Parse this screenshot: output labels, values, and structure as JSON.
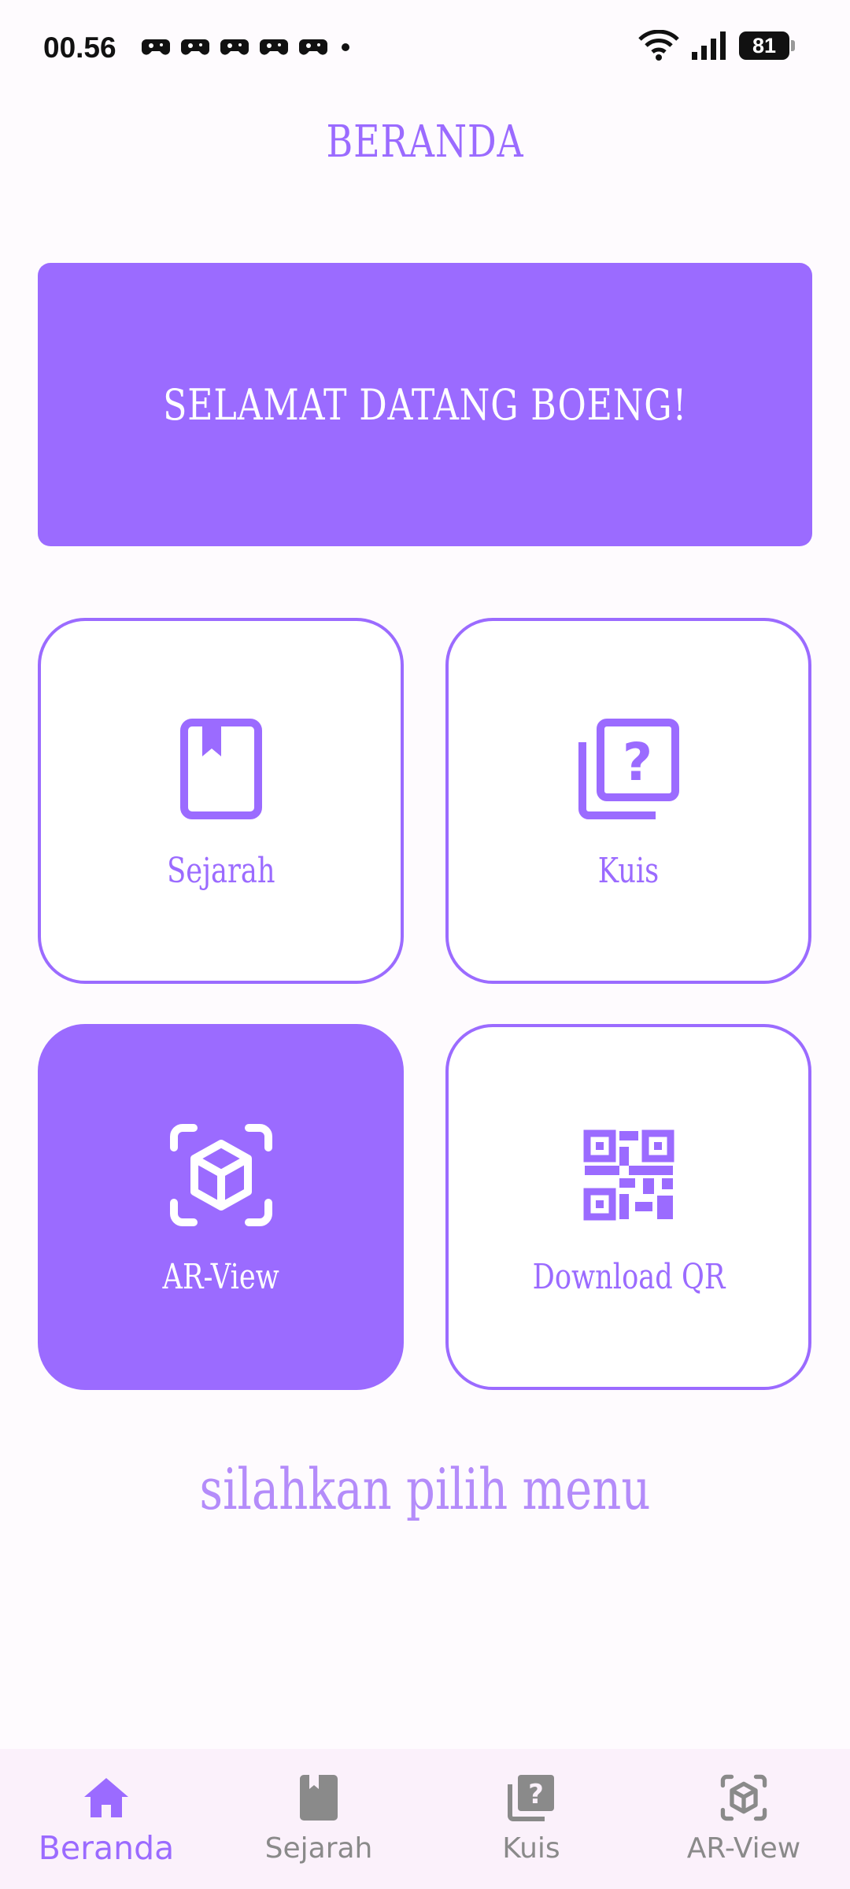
{
  "status_bar": {
    "time": "00.56",
    "battery": "81",
    "notification_icons": [
      "game-controller-icon",
      "game-controller-icon",
      "game-controller-icon",
      "game-controller-icon",
      "game-controller-icon",
      "dot-icon"
    ],
    "system_icons": [
      "wifi-icon",
      "signal-icon",
      "battery-icon"
    ]
  },
  "header": {
    "title": "BERANDA"
  },
  "banner": {
    "text": "SELAMAT DATANG BOENG!"
  },
  "menu": [
    {
      "label": "Sejarah",
      "icon": "book-icon",
      "active": false
    },
    {
      "label": "Kuis",
      "icon": "quiz-icon",
      "active": false
    },
    {
      "label": "AR-View",
      "icon": "ar-cube-icon",
      "active": true
    },
    {
      "label": "Download QR",
      "icon": "qr-code-icon",
      "active": false
    }
  ],
  "hint": "silahkan pilih menu",
  "bottom_nav": [
    {
      "label": "Beranda",
      "icon": "home-icon",
      "active": true
    },
    {
      "label": "Sejarah",
      "icon": "book-icon",
      "active": false
    },
    {
      "label": "Kuis",
      "icon": "quiz-icon",
      "active": false
    },
    {
      "label": "AR-View",
      "icon": "ar-cube-icon",
      "active": false
    }
  ],
  "colors": {
    "accent": "#9b6bff",
    "hint": "#b48cfa",
    "nav_background": "#fbf1fb",
    "nav_inactive": "#8a8a8a"
  }
}
